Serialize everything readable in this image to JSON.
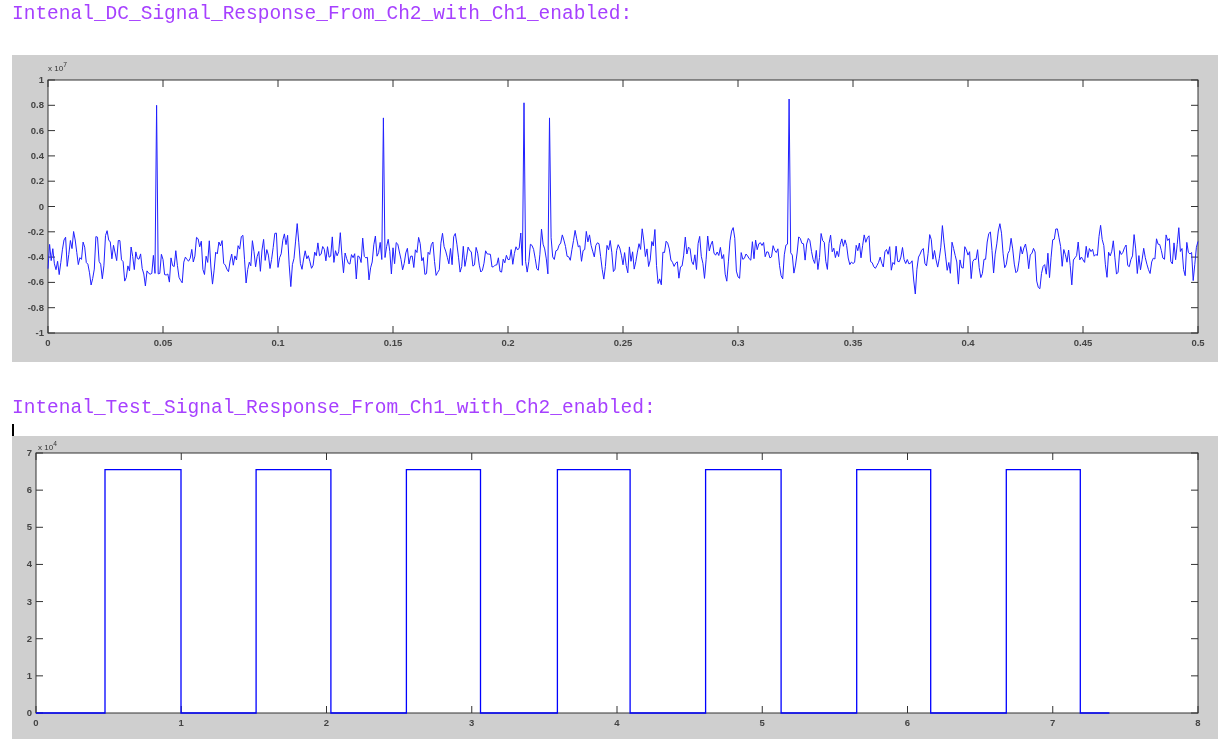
{
  "sections": [
    {
      "heading": "Intenal_DC_Signal_Response_From_Ch2_with_Ch1_enabled:",
      "caret": false,
      "plot": {
        "kind": "waveform",
        "multiplier": "x 10$^{7}$",
        "xticks": [
          "0",
          "0.05",
          "0.1",
          "0.15",
          "0.2",
          "0.25",
          "0.3",
          "0.35",
          "0.4",
          "0.45",
          "0.5"
        ],
        "yticks": [
          "1",
          "0.8",
          "0.6",
          "0.4",
          "0.2",
          "0",
          "-0.2",
          "-0.4",
          "-0.6",
          "-0.8",
          "-1"
        ]
      }
    },
    {
      "heading": "Intenal_Test_Signal_Response_From_Ch1_with_Ch2_enabled:",
      "caret": true,
      "plot": {
        "kind": "chart",
        "chart_data": {
          "type": "line",
          "x": [
            0,
            0.475,
            0.475,
            0.998,
            0.998,
            1.515,
            1.515,
            2.03,
            2.03,
            2.55,
            2.55,
            3.06,
            3.06,
            3.59,
            3.59,
            4.09,
            4.09,
            4.61,
            4.61,
            5.13,
            5.13,
            5.65,
            5.65,
            6.16,
            6.16,
            6.68,
            6.68,
            7.19,
            7.19,
            7.39
          ],
          "series": [
            {
              "color": "#0000ff",
              "values": [
                0,
                0,
                6.55,
                6.55,
                0,
                0,
                6.55,
                6.55,
                0,
                0,
                6.55,
                6.55,
                0,
                0,
                6.55,
                6.55,
                0,
                0,
                6.55,
                6.55,
                0,
                0,
                6.55,
                6.55,
                0,
                0,
                6.55,
                6.55,
                0,
                0
              ]
            }
          ],
          "xlim": [
            0,
            8
          ],
          "ylim": [
            0,
            7
          ],
          "xticks": [
            0,
            1,
            2,
            3,
            4,
            5,
            6,
            7,
            8
          ],
          "yticks": [
            0,
            1,
            2,
            3,
            4,
            5,
            6,
            7
          ],
          "annotations": [
            "x 10$^{4}$"
          ]
        }
      }
    }
  ]
}
